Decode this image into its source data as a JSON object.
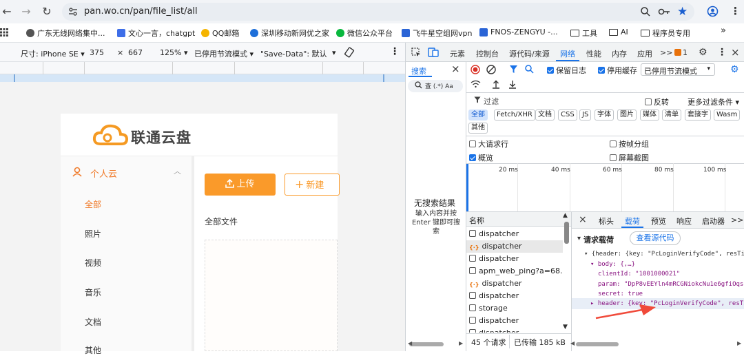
{
  "browser": {
    "url": "pan.wo.cn/pan/file_list/all",
    "bookmarks": [
      "广东无线网络集中...",
      "文心一言，chatgpt",
      "QQ邮箱",
      "深圳移动新网优之家",
      "微信公众平台",
      "飞牛星空组网vpn",
      "FNOS-ZENGYU -...",
      "工具",
      "AI",
      "程序员专用"
    ],
    "more": "»"
  },
  "device_toolbar": {
    "size_label": "尺寸: iPhone SE ▾",
    "width": "375",
    "x": "×",
    "height": "667",
    "zoom": "125% ▾",
    "throttle": "已停用节流模式 ▾",
    "save_data": "\"Save-Data\": 默认",
    "save_data_arrow": "▾"
  },
  "page": {
    "logo_text": "联通云盘",
    "section": "个人云",
    "nav": [
      "全部",
      "照片",
      "视频",
      "音乐",
      "文档",
      "其他"
    ],
    "upload_label": "上传",
    "new_label": "新建",
    "all_files": "全部文件"
  },
  "devtools": {
    "tabs": [
      "元素",
      "控制台",
      "源代码/来源",
      "网络",
      "性能",
      "内存",
      "应用",
      ">>"
    ],
    "issue_count": "1",
    "search_title": "搜索",
    "search_close": "×",
    "search_opts": "查 (.*) Aa",
    "no_results": "无搜索结果",
    "no_results_hint": "输入内容并按 Enter 键即可搜索",
    "preserve_log": "保留日志",
    "disable_cache": "停用缓存",
    "throttle": "已停用节流模式",
    "filter_placeholder": "过滤",
    "invert": "反转",
    "more_filters": "更多过滤条件 ▾",
    "filter_chips": [
      "全部",
      "Fetch/XHR",
      "文档",
      "CSS",
      "JS",
      "字体",
      "图片",
      "媒体",
      "清单",
      "套接字",
      "Wasm",
      "其他"
    ],
    "big_rows": "大请求行",
    "group_by_frame": "按帧分组",
    "overview": "概览",
    "screenshots": "屏幕截图",
    "timeline": [
      "20 ms",
      "40 ms",
      "60 ms",
      "80 ms",
      "100 ms"
    ],
    "name_header": "名称",
    "requests": [
      "dispatcher",
      "dispatcher",
      "dispatcher",
      "apm_web_ping?a=68...",
      "dispatcher",
      "dispatcher",
      "storage",
      "dispatcher",
      "dispatcher"
    ],
    "status_requests": "45 个请求",
    "status_transferred": "已传输 185 kB",
    "detail_tabs": [
      "标头",
      "载荷",
      "预览",
      "响应",
      "启动器",
      ">>"
    ],
    "detail_close": "×",
    "payload_title": "请求载荷",
    "view_source": "查看源代码",
    "payload_lines": [
      "▾ {header: {key: \"PcLoginVerifyCode\", resTime",
      "▾ body: {,…}",
      "clientId: \"1001000021\"",
      "param: \"DpP8vEEYln4mRCGNiokcNu1e6gfiOqsg9",
      "secret: true",
      "▸ header: {key: \"PcLoginVerifyCode\", resTime"
    ]
  }
}
